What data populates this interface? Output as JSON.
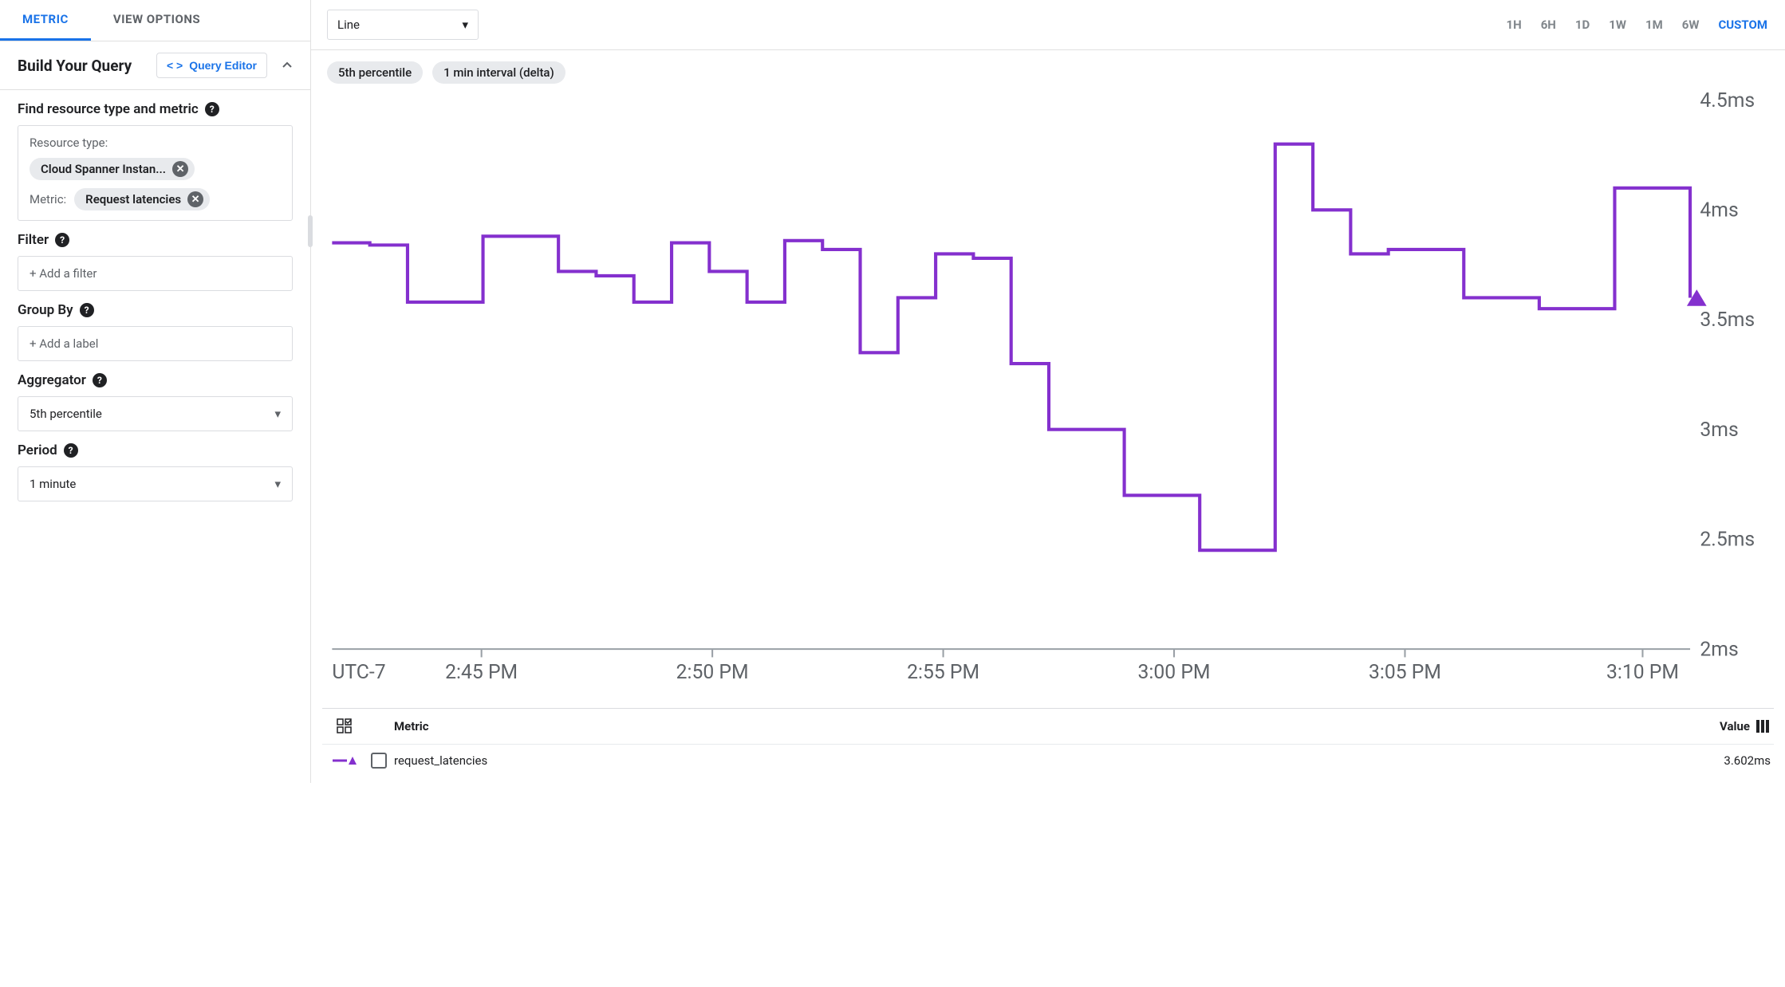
{
  "tabs": {
    "metric": "METRIC",
    "view_options": "VIEW OPTIONS"
  },
  "query": {
    "title": "Build Your Query",
    "editor_btn": "Query Editor",
    "find_section": "Find resource type and metric",
    "resource_type_label": "Resource type:",
    "resource_type_value": "Cloud Spanner Instan...",
    "metric_label": "Metric:",
    "metric_value": "Request latencies",
    "filter_section": "Filter",
    "filter_placeholder": "+ Add a filter",
    "groupby_section": "Group By",
    "groupby_placeholder": "+ Add a label",
    "aggregator_section": "Aggregator",
    "aggregator_value": "5th percentile",
    "period_section": "Period",
    "period_value": "1 minute"
  },
  "toolbar": {
    "chart_type": "Line",
    "ranges": [
      "1H",
      "6H",
      "1D",
      "1W",
      "1M",
      "6W",
      "CUSTOM"
    ],
    "active_range": "CUSTOM"
  },
  "badges": {
    "b1": "5th percentile",
    "b2": "1 min interval (delta)"
  },
  "chart_data": {
    "type": "line",
    "series_name": "request_latencies",
    "color": "#8430ce",
    "xlabel": "UTC-7",
    "x_ticks": [
      "2:45 PM",
      "2:50 PM",
      "2:55 PM",
      "3:00 PM",
      "3:05 PM",
      "3:10 PM"
    ],
    "y_ticks_ms": [
      2,
      2.5,
      3,
      3.5,
      4,
      4.5
    ],
    "ylim": [
      2,
      4.5
    ],
    "x": [
      0,
      1,
      2,
      3,
      4,
      5,
      6,
      7,
      8,
      9,
      10,
      11,
      12,
      13,
      14,
      15,
      16,
      17,
      18,
      19,
      20,
      21,
      22,
      23,
      24,
      25,
      26,
      27,
      28,
      29,
      30
    ],
    "values_ms": [
      3.85,
      3.84,
      3.58,
      3.58,
      3.88,
      3.88,
      3.72,
      3.7,
      3.58,
      3.85,
      3.72,
      3.58,
      3.86,
      3.82,
      3.35,
      3.6,
      3.8,
      3.78,
      3.3,
      3.0,
      3.0,
      2.7,
      2.7,
      2.45,
      2.45,
      4.3,
      4.0,
      3.8,
      3.82,
      3.82,
      3.6
    ],
    "tail_ms": [
      3.6,
      3.55,
      3.55,
      4.1,
      4.1,
      3.6
    ],
    "tail_x": [
      31,
      32,
      33,
      34,
      35,
      36
    ],
    "end_point_ms": 3.6
  },
  "legend": {
    "metric_header": "Metric",
    "value_header": "Value",
    "row_name": "request_latencies",
    "row_value": "3.602ms"
  }
}
